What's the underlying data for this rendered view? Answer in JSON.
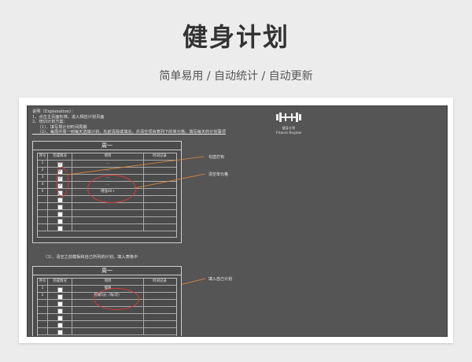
{
  "header": {
    "title": "健身计划",
    "subtitle": "简单易用 / 自动统计 / 自动更新"
  },
  "sheet": {
    "intro_lines": [
      "说明（Explanation）：",
      "1、点击主页面标准，进入相应计划页面",
      "2、培训计划方案：",
      "    （1）、填写周计划时间周期",
      "    （2）、每周中周一到每天选填计划，先前清除或填充，并清空项目表列下的单元格，填写每天的计划事项"
    ],
    "logo": {
      "icon": "dumbbell-icon",
      "line1": "健身计划",
      "line2": "Fitness Regime"
    },
    "step3": "（3）、清空之前模板和自己所列的计划，填入表格中",
    "callouts": [
      "勾选打钩",
      "清空单元格",
      "填入自己计划"
    ],
    "accent_color": "#d63a3a"
  },
  "table1": {
    "day": "周一",
    "columns": [
      "序号",
      "完成情况",
      "项目",
      "时间记录"
    ],
    "rows": [
      {
        "no": "1",
        "checked": true,
        "item": "...",
        "time": ""
      },
      {
        "no": "2",
        "checked": true,
        "item": "...",
        "time": ""
      },
      {
        "no": "3",
        "checked": true,
        "item": "...",
        "time": ""
      },
      {
        "no": "4",
        "checked": true,
        "item": "...",
        "time": ""
      },
      {
        "no": "5",
        "checked": false,
        "item": "增强30+",
        "time": ""
      },
      {
        "no": "",
        "checked": false,
        "item": "",
        "time": ""
      },
      {
        "no": "",
        "checked": false,
        "item": "",
        "time": ""
      },
      {
        "no": "",
        "checked": false,
        "item": "",
        "time": ""
      },
      {
        "no": "",
        "checked": false,
        "item": "",
        "time": ""
      },
      {
        "no": "",
        "checked": false,
        "item": "",
        "time": ""
      }
    ]
  },
  "table2": {
    "day": "周一",
    "columns": [
      "序号",
      "完成情况",
      "项目",
      "时间记录"
    ],
    "rows": [
      {
        "no": "1",
        "checked": false,
        "item": "慢跑",
        "time": ""
      },
      {
        "no": "2",
        "checked": false,
        "item": "跳绳5分（每/次）",
        "time": ""
      },
      {
        "no": "",
        "checked": false,
        "item": "",
        "time": ""
      },
      {
        "no": "",
        "checked": false,
        "item": "",
        "time": ""
      },
      {
        "no": "",
        "checked": false,
        "item": "",
        "time": ""
      },
      {
        "no": "",
        "checked": false,
        "item": "",
        "time": ""
      },
      {
        "no": "",
        "checked": false,
        "item": "",
        "time": ""
      }
    ]
  }
}
